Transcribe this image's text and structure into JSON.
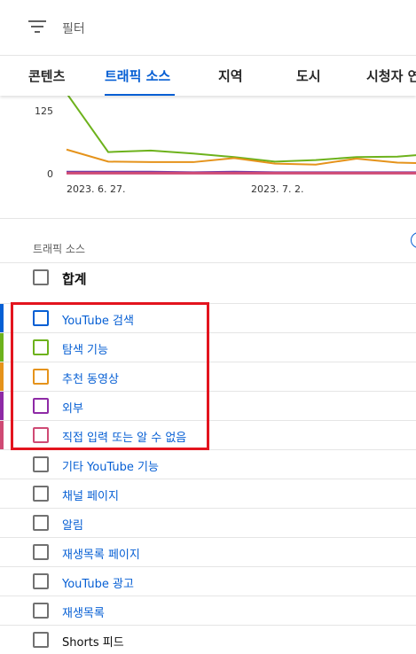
{
  "filter": {
    "label": "필터"
  },
  "tabs": [
    {
      "label": "콘텐츠",
      "active": false
    },
    {
      "label": "트래픽 소스",
      "active": true
    },
    {
      "label": "지역",
      "active": false
    },
    {
      "label": "도시",
      "active": false
    },
    {
      "label": "시청자 연",
      "active": false
    }
  ],
  "chart_data": {
    "type": "line",
    "y_ticks": [
      "125",
      "0"
    ],
    "x_tick_labels": [
      "2023. 6. 27.",
      "2023. 7. 2."
    ],
    "series": [
      {
        "color": "#6db21c",
        "values": [
          160,
          43,
          46,
          40,
          33,
          24,
          27,
          33,
          34,
          40
        ]
      },
      {
        "color": "#e5931b",
        "values": [
          48,
          24,
          23,
          23,
          31,
          20,
          18,
          30,
          22,
          20
        ]
      },
      {
        "color": "#6c3ba8",
        "values": [
          3,
          3,
          3,
          2,
          3,
          2,
          2,
          2,
          2,
          2
        ]
      },
      {
        "color": "#cf4a74",
        "values": [
          1,
          1,
          1,
          1,
          1,
          1,
          1,
          1,
          1,
          1
        ]
      }
    ]
  },
  "table": {
    "title": "트래픽 소스",
    "total_label": "합계",
    "rows": [
      {
        "label": "YouTube 검색",
        "color": "#065fd4"
      },
      {
        "label": "탐색 기능",
        "color": "#6db21c"
      },
      {
        "label": "추천 동영상",
        "color": "#e5931b"
      },
      {
        "label": "외부",
        "color": "#8e2aa6"
      },
      {
        "label": "직접 입력 또는 알 수 없음",
        "color": "#cf4a74"
      },
      {
        "label": "기타 YouTube 기능",
        "color": ""
      },
      {
        "label": "채널 페이지",
        "color": ""
      },
      {
        "label": "알림",
        "color": ""
      },
      {
        "label": "재생목록 페이지",
        "color": ""
      },
      {
        "label": "YouTube 광고",
        "color": ""
      },
      {
        "label": "재생목록",
        "color": ""
      },
      {
        "label": "Shorts 피드",
        "color": ""
      }
    ]
  },
  "colors": {
    "accent": "#065fd4",
    "highlight": "#e3141e"
  }
}
